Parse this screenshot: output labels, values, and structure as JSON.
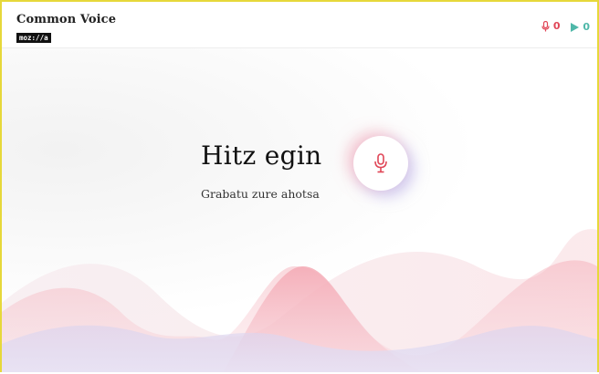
{
  "header": {
    "logo_title": "Common Voice",
    "logo_sub": "moz://a",
    "record_count": "0",
    "play_count": "0"
  },
  "hero": {
    "title": "Hitz egin",
    "subtitle": "Grabatu zure ahotsa"
  },
  "icons": {
    "record": "microphone-icon",
    "play": "play-icon"
  },
  "colors": {
    "accent_red": "#e04657",
    "accent_teal": "#4fb8a9",
    "frame": "#e6d83a"
  }
}
